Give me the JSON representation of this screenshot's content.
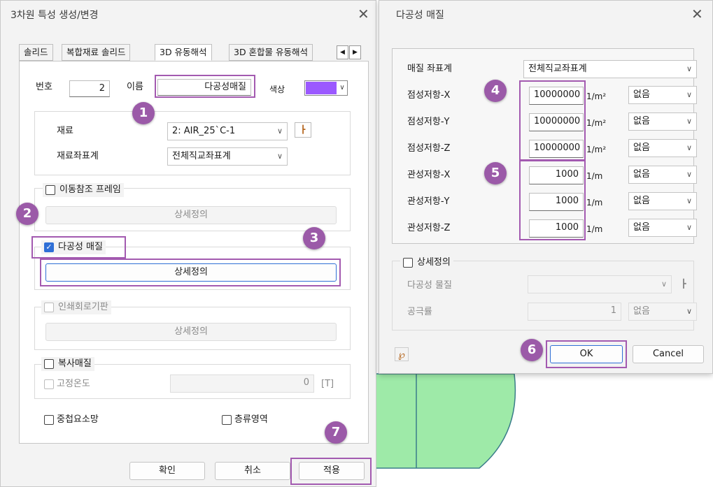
{
  "left": {
    "title": "3차원 특성 생성/변경",
    "tabs": [
      "솔리드",
      "복합재료 솔리드",
      "3D 유동해석",
      "3D 혼합물 유동해석"
    ],
    "number_label": "번호",
    "number_value": "2",
    "name_label": "이름",
    "name_value": "다공성매질",
    "color_label": "색상",
    "color_value": "#9b59ff",
    "material_label": "재료",
    "material_value": "2: AIR_25`C-1",
    "material_cs_label": "재료좌표계",
    "material_cs_value": "전체직교좌표계",
    "moving_frame_label": "이동참조 프레임",
    "detail_label": "상세정의",
    "porous_label": "다공성 매질",
    "pcb_label": "인쇄회로기판",
    "radiation_label": "복사매질",
    "fixed_temp_label": "고정온도",
    "fixed_temp_value": "0",
    "fixed_temp_unit": "[T]",
    "overlap_label": "중첩요소망",
    "laminar_label": "층류영역",
    "ok_label": "확인",
    "cancel_label": "취소",
    "apply_label": "적용"
  },
  "right": {
    "title": "다공성 매질",
    "cs_label": "매질 좌표계",
    "cs_value": "전체직교좌표계",
    "rows": [
      {
        "label": "점성저항-X",
        "value": "10000000",
        "unit": "1/m²",
        "opt": "없음"
      },
      {
        "label": "점성저항-Y",
        "value": "10000000",
        "unit": "1/m²",
        "opt": "없음"
      },
      {
        "label": "점성저항-Z",
        "value": "10000000",
        "unit": "1/m²",
        "opt": "없음"
      },
      {
        "label": "관성저항-X",
        "value": "1000",
        "unit": "1/m",
        "opt": "없음"
      },
      {
        "label": "관성저항-Y",
        "value": "1000",
        "unit": "1/m",
        "opt": "없음"
      },
      {
        "label": "관성저항-Z",
        "value": "1000",
        "unit": "1/m",
        "opt": "없음"
      }
    ],
    "detail_label": "상세정의",
    "porous_material_label": "다공성 물질",
    "porosity_label": "공극률",
    "porosity_value": "1",
    "porosity_opt": "없음",
    "ok_label": "OK",
    "cancel_label": "Cancel"
  },
  "badges": [
    "1",
    "2",
    "3",
    "4",
    "5",
    "6",
    "7"
  ],
  "colors": {
    "highlight": "#a35ab0",
    "badge": "#9b5aa8",
    "checkbox": "#2f6fd6",
    "surface": "#8fe4a6"
  }
}
